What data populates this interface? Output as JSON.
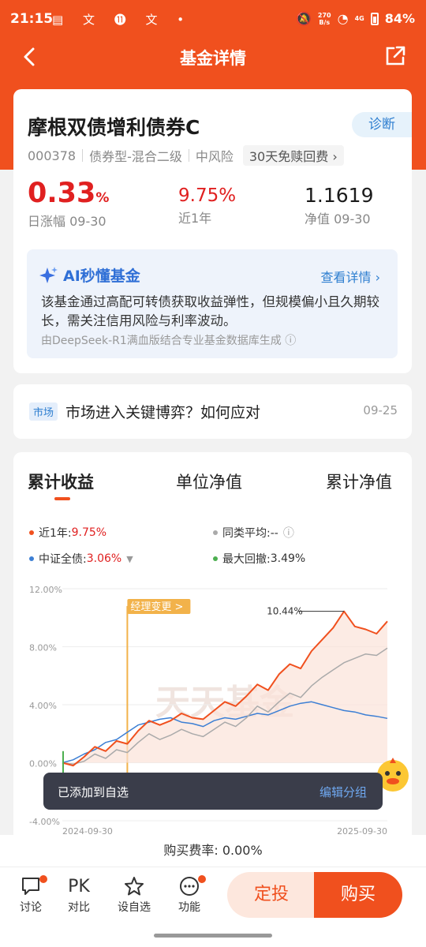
{
  "status_bar": {
    "time": "21:15",
    "left_icons": "▤ 文 ⓫ 文 •",
    "net_speed_top": "270",
    "net_speed_bottom": "B/s",
    "signal": "4G",
    "battery": "84%"
  },
  "nav": {
    "title": "基金详情",
    "back_icon": "back-arrow-icon",
    "share_icon": "share-icon"
  },
  "fund": {
    "name": "摩根双债增利债券C",
    "diagnose_label": "诊断",
    "code": "000378",
    "type": "债券型-混合二级",
    "risk": "中风险",
    "redeem_label": "30天免赎回费 ›",
    "daily_change_value": "0.33",
    "daily_change_unit": "%",
    "daily_change_label": "日涨幅 09-30",
    "yearly_value": "9.75%",
    "yearly_label": "近1年",
    "nav_value": "1.1619",
    "nav_label": "净值 09-30"
  },
  "ai": {
    "title": "AI秒懂基金",
    "more": "查看详情 ›",
    "text": "该基金通过高配可转债获取收益弹性，但规模偏小且久期较长，需关注信用风险与利率波动。",
    "source": "由DeepSeek-R1满血版结合专业基金数据库生成 ⓘ"
  },
  "news": {
    "tag": "市场",
    "title": "市场进入关键博弈？如何应对",
    "date": "09-25"
  },
  "tabs": [
    "累计收益",
    "单位净值",
    "累计净值"
  ],
  "legend": {
    "fund_label": "近1年:",
    "fund_value": "9.75%",
    "peer_label": "同类平均:--",
    "index_label": "中证全债:",
    "index_value": "3.06%",
    "drawdown_label": "最大回撤:",
    "drawdown_value": "3.49%"
  },
  "colors": {
    "accent": "#f0501e",
    "red": "#e02020",
    "blue": "#3c7fd4",
    "gray": "#aaaaaa",
    "green": "#4caf50"
  },
  "chart_data": {
    "type": "line",
    "x_start": "2024-09-30",
    "x_end": "2025-09-30",
    "ylim": [
      -4,
      12
    ],
    "yticks": [
      "12.00%",
      "8.00%",
      "4.00%",
      "0.00%",
      "-4.00%"
    ],
    "peak_label": "10.44%",
    "event_label": "经理变更 >",
    "watermark": "天天基金",
    "series": [
      {
        "name": "近1年",
        "values": [
          0,
          -0.2,
          0.4,
          1.1,
          0.8,
          1.5,
          1.3,
          2.2,
          2.9,
          2.6,
          2.9,
          3.4,
          3.1,
          3.0,
          3.6,
          4.2,
          3.9,
          4.6,
          5.4,
          5.0,
          6.1,
          6.8,
          6.5,
          7.7,
          8.5,
          9.3,
          10.44,
          9.4,
          9.2,
          8.9,
          9.75
        ]
      },
      {
        "name": "同类平均",
        "values": [
          0,
          -0.1,
          0.1,
          0.6,
          0.3,
          0.9,
          0.7,
          1.4,
          2.0,
          1.6,
          1.9,
          2.3,
          2.0,
          1.8,
          2.3,
          2.8,
          2.5,
          3.1,
          3.9,
          3.5,
          4.2,
          4.8,
          4.5,
          5.3,
          5.9,
          6.4,
          6.9,
          7.2,
          7.5,
          7.4,
          7.9
        ]
      },
      {
        "name": "中证全债",
        "values": [
          0,
          0.2,
          0.6,
          0.9,
          1.4,
          1.6,
          2.1,
          2.6,
          2.8,
          3.0,
          3.1,
          2.8,
          2.7,
          2.5,
          2.9,
          3.1,
          3.0,
          3.2,
          3.4,
          3.3,
          3.6,
          3.9,
          4.1,
          4.2,
          4.0,
          3.8,
          3.6,
          3.5,
          3.3,
          3.2,
          3.06
        ]
      }
    ]
  },
  "toast": {
    "message": "已添加到自选",
    "action": "编辑分组"
  },
  "fee": "购买费率: 0.00%",
  "bottom": {
    "discuss": "讨论",
    "compare_icon_text": "PK",
    "compare": "对比",
    "favorite": "设自选",
    "functions": "功能",
    "dingtou": "定投",
    "buy": "购买"
  }
}
